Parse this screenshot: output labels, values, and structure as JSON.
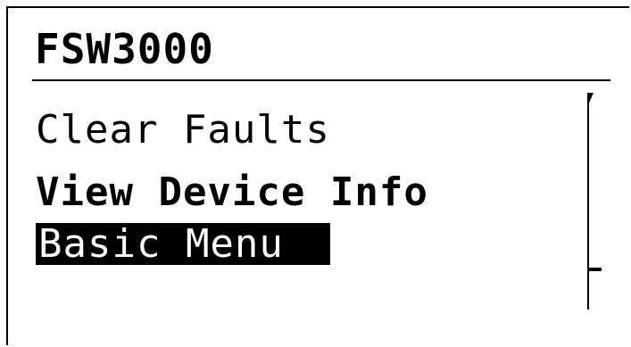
{
  "device": {
    "title": "FSW3000"
  },
  "menu": {
    "items": [
      {
        "label": "Clear Faults",
        "state": "normal"
      },
      {
        "label": "View Device Info",
        "state": "bold"
      },
      {
        "label": "Basic Menu",
        "state": "selected"
      }
    ]
  },
  "scrollbar": {
    "icon": "scroll-up-arrow-icon"
  },
  "colors": {
    "background": "#ffffff",
    "foreground": "#000000",
    "highlight_background": "#000000",
    "highlight_text": "#ffffff"
  }
}
